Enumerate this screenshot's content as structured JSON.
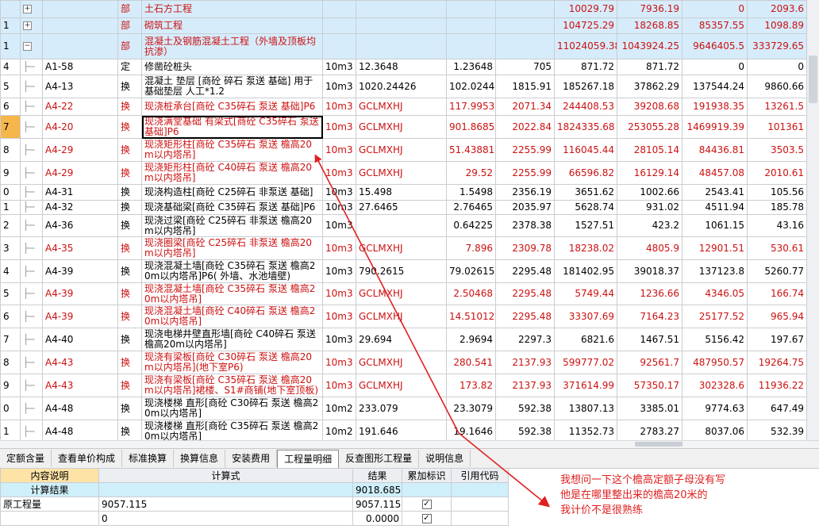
{
  "rows": [
    {
      "idx": "",
      "exp": "+",
      "code": "",
      "type": "部",
      "name": "土石方工程",
      "unit": "",
      "q1": "",
      "q2": "",
      "price": "",
      "total": "10029.79",
      "labor": "7936.19",
      "mat": "0",
      "mach": "2093.6",
      "style": "sec"
    },
    {
      "idx": "1",
      "exp": "+",
      "code": "",
      "type": "部",
      "name": "砌筑工程",
      "unit": "",
      "q1": "",
      "q2": "",
      "price": "",
      "total": "104725.29",
      "labor": "18268.85",
      "mat": "85357.55",
      "mach": "1098.89",
      "style": "sec"
    },
    {
      "idx": "1",
      "exp": "−",
      "code": "",
      "type": "部",
      "name": "混凝土及钢筋混凝土工程（外墙及顶板均抗渗）",
      "unit": "",
      "q1": "",
      "q2": "",
      "price": "",
      "total": "11024059.38",
      "labor": "1043924.25",
      "mat": "9646405.5",
      "mach": "333729.65",
      "style": "sec"
    },
    {
      "idx": "4",
      "exp": "",
      "code": "A1-58",
      "type": "定",
      "name": "修凿砼桩头",
      "unit": "10m3",
      "q1": "12.3648",
      "q2": "1.23648",
      "price": "705",
      "total": "871.72",
      "labor": "871.72",
      "mat": "0",
      "mach": "0",
      "style": ""
    },
    {
      "idx": "5",
      "exp": "",
      "code": "A4-13",
      "type": "换",
      "name": "混凝土 垫层 [商砼 碎石 泵送 基础] 用于基础垫层 人工*1.2",
      "unit": "10m3",
      "q1": "1020.24426",
      "q2": "102.02443",
      "price": "1815.91",
      "total": "185267.18",
      "labor": "37862.29",
      "mat": "137544.24",
      "mach": "9860.66",
      "style": ""
    },
    {
      "idx": "6",
      "exp": "",
      "code": "A4-22",
      "type": "换",
      "name": "现浇桩承台[商砼 C35碎石 泵送 基础]P6",
      "unit": "10m3",
      "q1": "GCLMXHJ",
      "q2": "117.9953",
      "price": "2071.34",
      "total": "244408.53",
      "labor": "39208.68",
      "mat": "191938.35",
      "mach": "13261.5",
      "style": "red"
    },
    {
      "idx": "7",
      "exp": "",
      "code": "A4-20",
      "type": "换",
      "name": "现浇满堂基础 有梁式[商砼 C35碎石 泵送 基础]P6",
      "unit": "10m3",
      "q1": "GCLMXHJ",
      "q2": "901.8685",
      "price": "2022.84",
      "total": "1824335.68",
      "labor": "253055.28",
      "mat": "1469919.39",
      "mach": "101361",
      "style": "red sel"
    },
    {
      "idx": "8",
      "exp": "",
      "code": "A4-29",
      "type": "换",
      "name": "现浇矩形柱[商砼 C35碎石 泵送 檐高20m以内塔吊]",
      "unit": "10m3",
      "q1": "GCLMXHJ",
      "q2": "51.43881",
      "price": "2255.99",
      "total": "116045.44",
      "labor": "28105.14",
      "mat": "84436.81",
      "mach": "3503.5",
      "style": "red"
    },
    {
      "idx": "9",
      "exp": "",
      "code": "A4-29",
      "type": "换",
      "name": "现浇矩形柱[商砼 C40碎石 泵送 檐高20m以内塔吊]",
      "unit": "10m3",
      "q1": "GCLMXHJ",
      "q2": "29.52",
      "price": "2255.99",
      "total": "66596.82",
      "labor": "16129.14",
      "mat": "48457.08",
      "mach": "2010.61",
      "style": "red"
    },
    {
      "idx": "0",
      "exp": "",
      "code": "A4-31",
      "type": "换",
      "name": "现浇构造柱[商砼 C25碎石 非泵送 基础]",
      "unit": "10m3",
      "q1": "15.498",
      "q2": "1.5498",
      "price": "2356.19",
      "total": "3651.62",
      "labor": "1002.66",
      "mat": "2543.41",
      "mach": "105.56",
      "style": ""
    },
    {
      "idx": "1",
      "exp": "",
      "code": "A4-32",
      "type": "换",
      "name": "现浇基础梁[商砼 C35碎石 泵送 基础]P6",
      "unit": "10m3",
      "q1": "27.6465",
      "q2": "2.76465",
      "price": "2035.97",
      "total": "5628.74",
      "labor": "931.02",
      "mat": "4511.94",
      "mach": "185.78",
      "style": ""
    },
    {
      "idx": "2",
      "exp": "",
      "code": "A4-36",
      "type": "换",
      "name": "现浇过梁[商砼 C25碎石 非泵送 檐高20m以内塔吊]",
      "unit": "10m3",
      "q1": "",
      "q2": "0.64225",
      "price": "2378.38",
      "total": "1527.51",
      "labor": "423.2",
      "mat": "1061.15",
      "mach": "43.16",
      "style": ""
    },
    {
      "idx": "3",
      "exp": "",
      "code": "A4-35",
      "type": "换",
      "name": "现浇圈梁[商砼 C25碎石 非泵送 檐高20m以内塔吊]",
      "unit": "10m3",
      "q1": "GCLMXHJ",
      "q2": "7.896",
      "price": "2309.78",
      "total": "18238.02",
      "labor": "4805.9",
      "mat": "12901.51",
      "mach": "530.61",
      "style": "red"
    },
    {
      "idx": "4",
      "exp": "",
      "code": "A4-39",
      "type": "换",
      "name": "现浇混凝土墙[商砼 C35碎石 泵送 檐高20m以内塔吊]P6( 外墙、水池墙壁)",
      "unit": "10m3",
      "q1": "790.2615",
      "q2": "79.02615",
      "price": "2295.48",
      "total": "181402.95",
      "labor": "39018.37",
      "mat": "137123.8",
      "mach": "5260.77",
      "style": ""
    },
    {
      "idx": "5",
      "exp": "",
      "code": "A4-39",
      "type": "换",
      "name": "现浇混凝土墙[商砼 C35碎石 泵送 檐高20m以内塔吊]",
      "unit": "10m3",
      "q1": "GCLMXHJ",
      "q2": "2.50468",
      "price": "2295.48",
      "total": "5749.44",
      "labor": "1236.66",
      "mat": "4346.05",
      "mach": "166.74",
      "style": "red"
    },
    {
      "idx": "6",
      "exp": "",
      "code": "A4-39",
      "type": "换",
      "name": "现浇混凝土墙[商砼 C40碎石 泵送 檐高20m以内塔吊]",
      "unit": "10m3",
      "q1": "GCLMXHJ",
      "q2": "14.51012",
      "price": "2295.48",
      "total": "33307.69",
      "labor": "7164.23",
      "mat": "25177.52",
      "mach": "965.94",
      "style": "red"
    },
    {
      "idx": "7",
      "exp": "",
      "code": "A4-40",
      "type": "换",
      "name": "现浇电梯井壁直形墙[商砼 C40碎石 泵送 檐高20m以内塔吊]",
      "unit": "10m3",
      "q1": "29.694",
      "q2": "2.9694",
      "price": "2297.3",
      "total": "6821.6",
      "labor": "1467.51",
      "mat": "5156.42",
      "mach": "197.67",
      "style": ""
    },
    {
      "idx": "8",
      "exp": "",
      "code": "A4-43",
      "type": "换",
      "name": "现浇有梁板[商砼 C30碎石 泵送 檐高20m以内塔吊](地下室P6)",
      "unit": "10m3",
      "q1": "GCLMXHJ",
      "q2": "280.541",
      "price": "2137.93",
      "total": "599777.02",
      "labor": "92561.7",
      "mat": "487950.57",
      "mach": "19264.75",
      "style": "red"
    },
    {
      "idx": "9",
      "exp": "",
      "code": "A4-43",
      "type": "换",
      "name": "现浇有梁板[商砼 C35碎石 泵送 檐高20m以内塔吊]裙楼、S1#商铺(地下室顶板)",
      "unit": "10m3",
      "q1": "GCLMXHJ",
      "q2": "173.82",
      "price": "2137.93",
      "total": "371614.99",
      "labor": "57350.17",
      "mat": "302328.6",
      "mach": "11936.22",
      "style": "red"
    },
    {
      "idx": "0",
      "exp": "",
      "code": "A4-48",
      "type": "换",
      "name": "现浇楼梯 直形[商砼 C30碎石 泵送 檐高20m以内塔吊]",
      "unit": "10m2",
      "q1": "233.079",
      "q2": "23.3079",
      "price": "592.38",
      "total": "13807.13",
      "labor": "3385.01",
      "mat": "9774.63",
      "mach": "647.49",
      "style": ""
    },
    {
      "idx": "1",
      "exp": "",
      "code": "A4-48",
      "type": "换",
      "name": "现浇楼梯 直形[商砼 C35碎石 泵送 檐高20m以内塔吊]",
      "unit": "10m2",
      "q1": "191.646",
      "q2": "19.1646",
      "price": "592.38",
      "total": "11352.73",
      "labor": "2783.27",
      "mat": "8037.06",
      "mach": "532.39",
      "style": ""
    }
  ],
  "tabs": [
    "定额含量",
    "查看单价构成",
    "标准换算",
    "换算信息",
    "安装费用",
    "工程量明细",
    "反查图形工程量",
    "说明信息"
  ],
  "detail": {
    "headers": [
      "内容说明",
      "计算式",
      "结果",
      "累加标识",
      "引用代码"
    ],
    "rows": [
      {
        "a": "计算结果",
        "b": "",
        "c": "9018.685",
        "d": "",
        "e": ""
      },
      {
        "a": "原工程量",
        "b": "9057.115",
        "c": "9057.1150",
        "d": "✓",
        "e": ""
      },
      {
        "a": "",
        "b": "0",
        "c": "0.0000",
        "d": "✓",
        "e": ""
      }
    ]
  },
  "note": {
    "line1": "我想问一下这个檐高定额子母没有写",
    "line2": "他是在哪里整出来的檐高20米的",
    "line3": "我计价不是很熟练"
  },
  "colors": {
    "red": "#cc1111",
    "annotation": "#e02020",
    "section_bg": "#d6ecfb",
    "selected_row": "#f5b64a"
  }
}
